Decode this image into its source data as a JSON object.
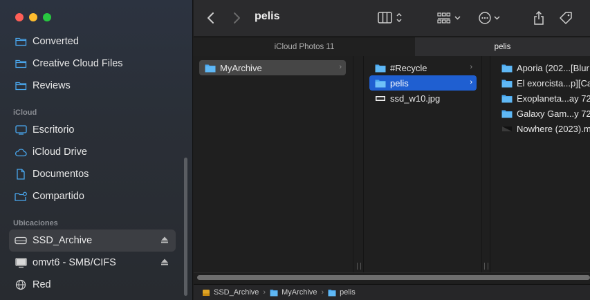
{
  "window": {
    "title": "pelis"
  },
  "sidebar": {
    "favorites": [
      {
        "label": "Converted",
        "icon": "folder-icon"
      },
      {
        "label": "Creative Cloud Files",
        "icon": "folder-icon"
      },
      {
        "label": "Reviews",
        "icon": "folder-icon"
      }
    ],
    "icloud_heading": "iCloud",
    "icloud": [
      {
        "label": "Escritorio",
        "icon": "desktop-icon"
      },
      {
        "label": "iCloud Drive",
        "icon": "cloud-icon"
      },
      {
        "label": "Documentos",
        "icon": "document-icon"
      },
      {
        "label": "Compartido",
        "icon": "shared-folder-icon"
      }
    ],
    "locations_heading": "Ubicaciones",
    "locations": [
      {
        "label": "SSD_Archive",
        "icon": "drive-icon",
        "selected": true
      },
      {
        "label": "omvt6 - SMB/CIFS",
        "icon": "monitor-icon"
      },
      {
        "label": "Red",
        "icon": "globe-icon"
      }
    ]
  },
  "tabs": [
    {
      "label": "iCloud Photos 11",
      "active": false
    },
    {
      "label": "pelis",
      "active": true
    }
  ],
  "columns": {
    "col1": [
      {
        "label": "MyArchive",
        "type": "folder"
      }
    ],
    "col2": [
      {
        "label": "#Recycle",
        "type": "folder"
      },
      {
        "label": "pelis",
        "type": "folder"
      },
      {
        "label": "ssd_w10.jpg",
        "type": "image"
      }
    ],
    "col3": [
      {
        "label": "Aporia (202...[Blur",
        "type": "folder"
      },
      {
        "label": "El exorcista...p][Ca",
        "type": "folder"
      },
      {
        "label": "Exoplaneta...ay 72",
        "type": "folder"
      },
      {
        "label": "Galaxy Gam...y 72",
        "type": "folder"
      },
      {
        "label": "Nowhere (2023).m",
        "type": "video"
      }
    ]
  },
  "pathbar": [
    {
      "label": "SSD_Archive",
      "icon": "drive-icon"
    },
    {
      "label": "MyArchive",
      "icon": "folder-icon"
    },
    {
      "label": "pelis",
      "icon": "folder-icon"
    }
  ],
  "colors": {
    "accent": "#1f5fd1",
    "folder": "#4aa8f0"
  }
}
